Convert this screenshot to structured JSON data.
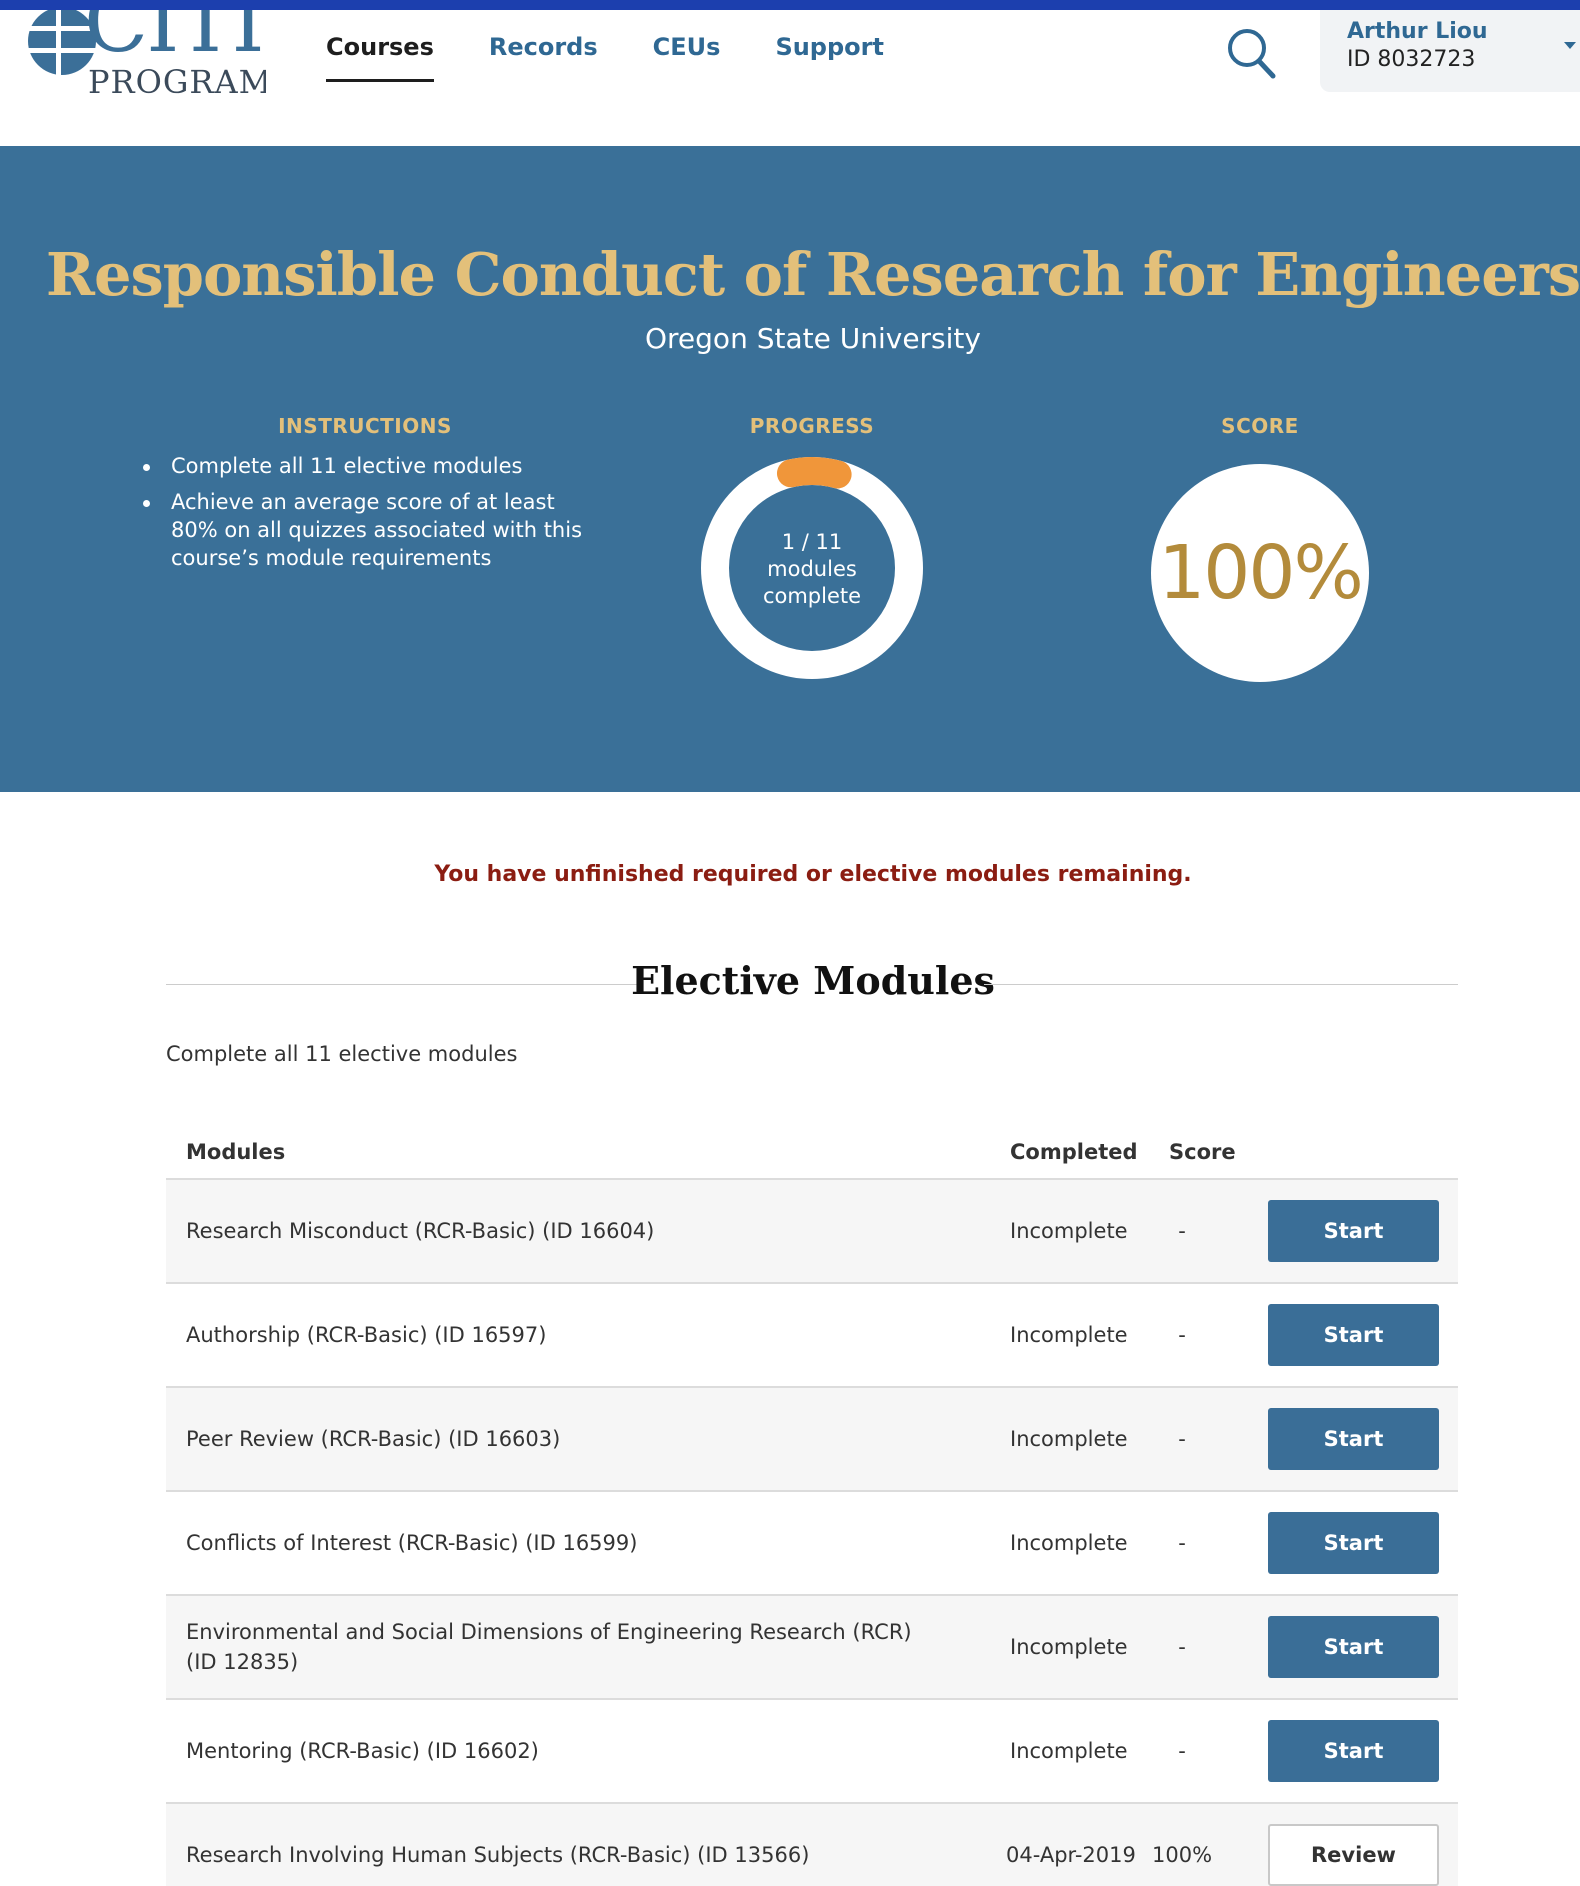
{
  "brand": {
    "logo_word": "CITI",
    "logo_sub": "PROGRAM"
  },
  "nav": {
    "items": [
      {
        "label": "Courses",
        "active": true
      },
      {
        "label": "Records",
        "active": false
      },
      {
        "label": "CEUs",
        "active": false
      },
      {
        "label": "Support",
        "active": false
      }
    ]
  },
  "user": {
    "name": "Arthur Liou",
    "id": "ID 8032723"
  },
  "course": {
    "title": "Responsible Conduct of Research for Engineers",
    "institution": "Oregon State University"
  },
  "instructions": {
    "heading": "INSTRUCTIONS",
    "items": [
      "Complete all 11 elective modules",
      "Achieve an average score of at least 80% on all quizzes associated with this course’s module requirements"
    ]
  },
  "progress": {
    "heading": "PROGRESS",
    "line1": "1 / 11",
    "line2": "modules",
    "line3": "complete",
    "completed": 1,
    "total": 11
  },
  "score": {
    "heading": "SCORE",
    "value": "100%"
  },
  "warning": "You have unfinished required or elective modules remaining.",
  "section": {
    "title": "Elective Modules",
    "description": "Complete all 11 elective modules"
  },
  "table": {
    "headers": {
      "module": "Modules",
      "completed": "Completed",
      "score": "Score"
    },
    "rows": [
      {
        "module": "Research Misconduct (RCR-Basic) (ID 16604)",
        "completed": "Incomplete",
        "score": "-",
        "action": "Start"
      },
      {
        "module": "Authorship (RCR-Basic) (ID 16597)",
        "completed": "Incomplete",
        "score": "-",
        "action": "Start"
      },
      {
        "module": "Peer Review (RCR-Basic) (ID 16603)",
        "completed": "Incomplete",
        "score": "-",
        "action": "Start"
      },
      {
        "module": "Conflicts of Interest (RCR-Basic) (ID 16599)",
        "completed": "Incomplete",
        "score": "-",
        "action": "Start"
      },
      {
        "module": "Environmental and Social Dimensions of Engineering Research (RCR) (ID 12835)",
        "completed": "Incomplete",
        "score": "-",
        "action": "Start"
      },
      {
        "module": "Mentoring (RCR-Basic) (ID 16602)",
        "completed": "Incomplete",
        "score": "-",
        "action": "Start"
      },
      {
        "module": "Research Involving Human Subjects (RCR-Basic) (ID 13566)",
        "completed": "04-Apr-2019",
        "score": "100%",
        "action": "Review"
      }
    ]
  },
  "colors": {
    "hero_bg": "#3a7098",
    "accent_gold": "#e3c07a",
    "progress_fill": "#f0963a",
    "primary_button": "#3a6e97",
    "warning_text": "#8b1d12"
  }
}
